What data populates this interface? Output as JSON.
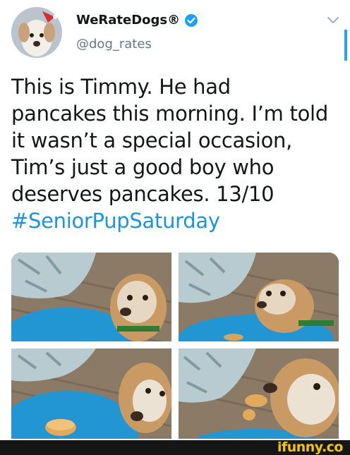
{
  "account": {
    "display_name": "WeRateDogs®",
    "handle": "@dog_rates",
    "verified": true,
    "avatar_icon": "dog-avatar"
  },
  "tweet": {
    "lines": [
      "This is Timmy. He had",
      "pancakes this morning. I’m told",
      "it wasn’t a special occasion,",
      "Tim’s just a good boy who",
      "deserves pancakes. 13/10"
    ],
    "hashtag": "#SeniorPupSaturday"
  },
  "media": {
    "photo_count": 4,
    "photos": [
      "dog-photo",
      "dog-photo",
      "dog-photo",
      "dog-photo"
    ]
  },
  "watermark": {
    "text": "ifunny.co"
  },
  "colors": {
    "link_blue": "#1b95e0",
    "verified_blue": "#1da1f2",
    "handle_gray": "#657786",
    "watermark_yellow": "#f5c400"
  }
}
